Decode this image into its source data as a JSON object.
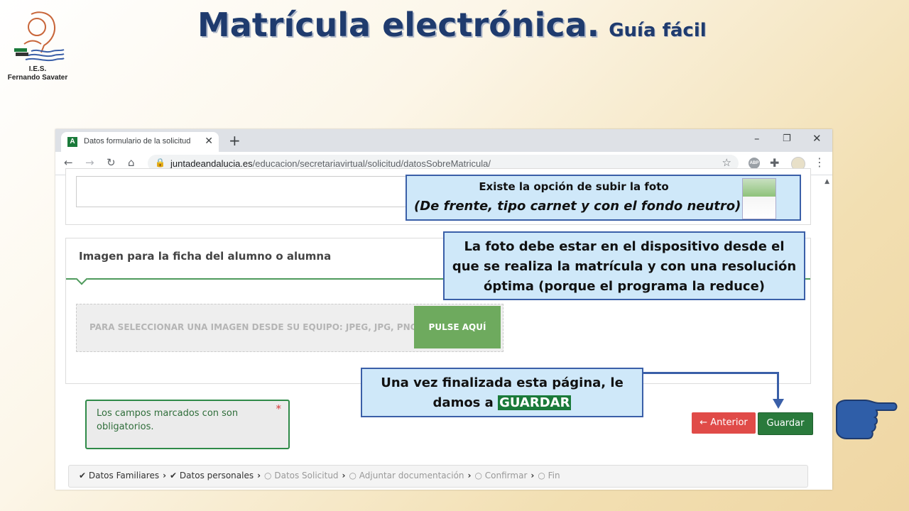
{
  "slide": {
    "title": "Matrícula electrónica.",
    "subtitle": "Guía fácil",
    "logo_line1": "I.E.S.",
    "logo_line2": "Fernando Savater"
  },
  "browser": {
    "tab_title": "Datos formulario de la solicitud",
    "tab_favicon": "A",
    "url_host": "juntadeandalucia.es",
    "url_path": "/educacion/secretariavirtual/solicitud/datosSobreMatricula/",
    "extension_abp": "ABP"
  },
  "form": {
    "image_section_title": "Imagen para la ficha del alumno o alumna",
    "upload_placeholder": "PARA SELECCIONAR UNA IMAGEN DESDE SU EQUIPO: JPEG, JPG, PNG",
    "upload_button": "PULSE AQUÍ",
    "required_note_before": "Los campos marcados con ",
    "required_note_star": "*",
    "required_note_after": " son obligatorios.",
    "prev_button": "Anterior",
    "save_button": "Guardar"
  },
  "steps": [
    {
      "label": "Datos Familiares",
      "done": true
    },
    {
      "label": "Datos personales",
      "done": true
    },
    {
      "label": "Datos Solicitud",
      "done": false
    },
    {
      "label": "Adjuntar documentación",
      "done": false
    },
    {
      "label": "Confirmar",
      "done": false
    },
    {
      "label": "Fin",
      "done": false
    }
  ],
  "callouts": {
    "photo_option_line1": "Existe la opción de subir la foto",
    "photo_option_line2": "(De frente, tipo carnet y con el fondo neutro)",
    "photo_device": "La foto debe estar en el dispositivo desde el que se realiza la matrícula y con una resolución óptima (porque el programa la reduce)",
    "finish_text": "Una vez finalizada esta página, le damos a",
    "finish_highlight": "GUARDAR"
  },
  "colors": {
    "title": "#1f3b6e",
    "callout_bg": "#cfe8f9",
    "callout_border": "#3a5fa8",
    "save_green": "#2a7a3c",
    "prev_red": "#e04b48",
    "upload_green": "#6eaa5e"
  }
}
